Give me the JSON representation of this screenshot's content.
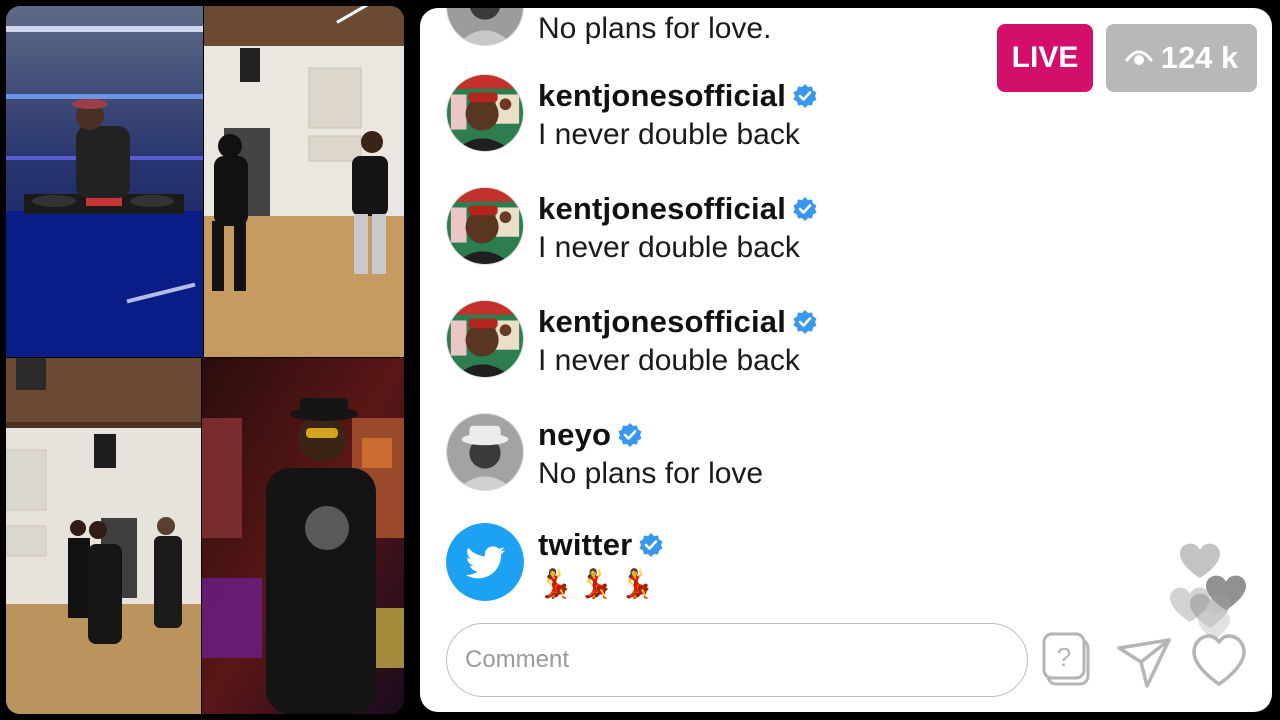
{
  "live": {
    "badge_label": "LIVE",
    "viewer_count": "124 k"
  },
  "comments": [
    {
      "username": "",
      "message": "No plans for love.",
      "avatar": "neyo-avatar"
    },
    {
      "username": "kentjonesofficial",
      "message": "I never double back",
      "verified": true,
      "avatar": "kentjones-avatar"
    },
    {
      "username": "kentjonesofficial",
      "message": "I never double back",
      "verified": true,
      "avatar": "kentjones-avatar"
    },
    {
      "username": "kentjonesofficial",
      "message": "I never double back",
      "verified": true,
      "avatar": "kentjones-avatar"
    },
    {
      "username": "neyo",
      "message": "No plans for love",
      "verified": true,
      "avatar": "neyo-avatar"
    },
    {
      "username": "twitter",
      "message": "💃💃💃",
      "verified": true,
      "avatar": "twitter-bird-icon"
    }
  ],
  "comment_input": {
    "placeholder": "Comment",
    "value": ""
  },
  "icons": {
    "question": "question-box-icon",
    "send": "paper-plane-icon",
    "like": "heart-outline-icon",
    "floating": "floating-hearts-icon",
    "viewers": "eye-icon",
    "verified": "verified-badge-icon"
  },
  "colors": {
    "live_badge": "#d30f6a",
    "viewer_badge": "#b8b8b8",
    "verified": "#3897f0",
    "twitter": "#1da1f2"
  }
}
